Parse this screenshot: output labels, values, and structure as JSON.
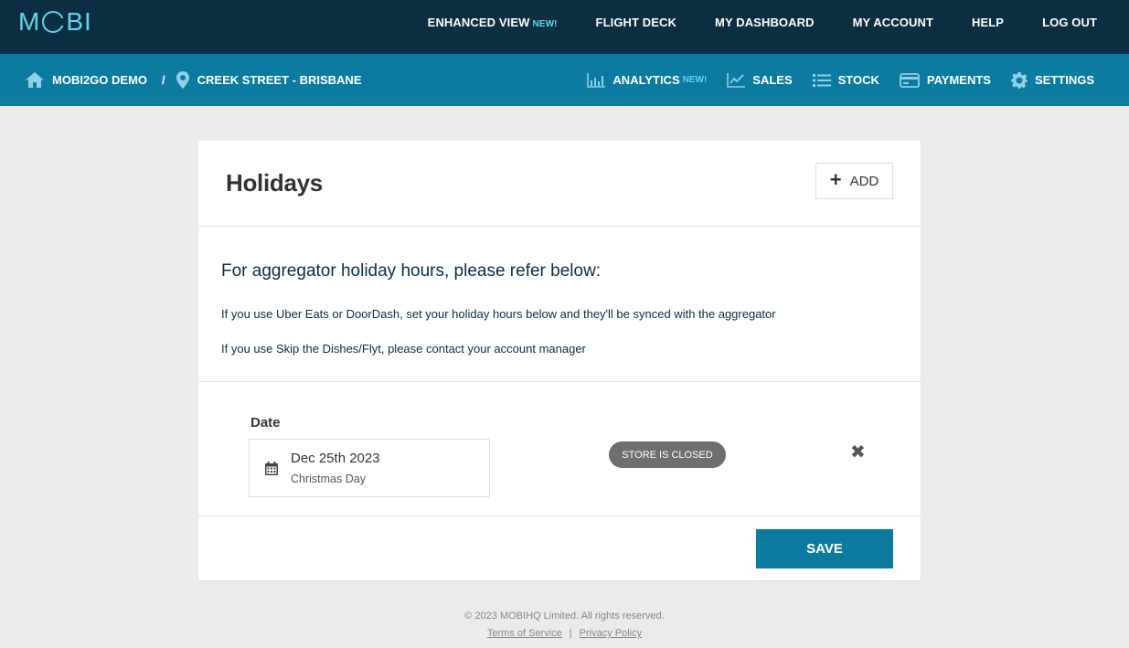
{
  "brand": {
    "logo_text": "MOBI"
  },
  "topnav": {
    "enhanced_view": "ENHANCED VIEW",
    "enhanced_new": "NEW!",
    "flight_deck": "FLIGHT DECK",
    "my_dashboard": "MY DASHBOARD",
    "my_account": "MY ACCOUNT",
    "help": "HELP",
    "log_out": "LOG OUT"
  },
  "breadcrumb": {
    "org": "MOBI2GO DEMO",
    "separator": "/",
    "store": "CREEK STREET - BRISBANE"
  },
  "subnav": {
    "analytics": "ANALYTICS",
    "analytics_new": "NEW!",
    "sales": "SALES",
    "stock": "STOCK",
    "payments": "PAYMENTS",
    "settings": "SETTINGS"
  },
  "card": {
    "title": "Holidays",
    "add_label": "ADD",
    "info_heading": "For aggregator holiday hours, please refer below:",
    "info_line1": "If you use Uber Eats or DoorDash, set your holiday hours below and they'll be synced with the aggregator",
    "info_line2": "If you use Skip the Dishes/Flyt, please contact your account manager"
  },
  "holiday": {
    "date_label": "Date",
    "date": "Dec 25th 2023",
    "name": "Christmas Day",
    "status": "STORE IS CLOSED"
  },
  "save_label": "SAVE",
  "footer": {
    "copyright": "© 2023 MOBIHQ Limited. All rights reserved.",
    "terms": "Terms of Service",
    "divider": "|",
    "privacy": "Privacy Policy"
  },
  "colors": {
    "topbar": "#0b2e42",
    "subbar": "#0b7ba0",
    "accent": "#5fd4ee",
    "badge": "#6f6f6f"
  }
}
